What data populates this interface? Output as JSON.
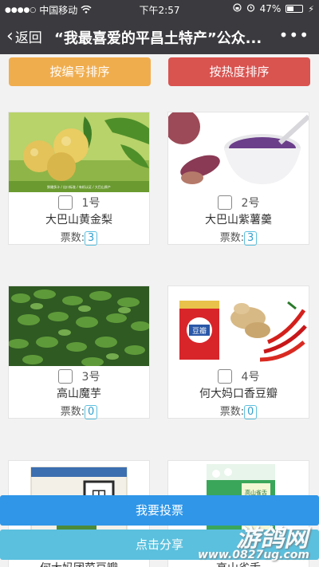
{
  "status_bar": {
    "carrier": "中国移动",
    "time": "下午2:57",
    "battery": "47%",
    "battery_level": 0.47
  },
  "nav": {
    "back_label": "返回",
    "title": "“我最喜爱的平昌土特产”公众...",
    "more": "•••"
  },
  "sort": {
    "by_number": "按编号排序",
    "by_heat": "按热度排序"
  },
  "votes_prefix": "票数:",
  "cards": [
    {
      "number": "1号",
      "name": "大巴山黄金梨",
      "votes": "3",
      "caption": "鲜嫩多汁 / 出口标准 / 有机认证 / 大巴山原产"
    },
    {
      "number": "2号",
      "name": "大巴山紫薯羹",
      "votes": "3"
    },
    {
      "number": "3号",
      "name": "高山魔芋",
      "votes": "0"
    },
    {
      "number": "4号",
      "name": "何大妈口香豆瓣",
      "votes": "0",
      "jar_label": "豆瓣"
    },
    {
      "number": "",
      "name": "何大妈团菜豆瓣",
      "votes": "",
      "box_label": "田"
    },
    {
      "number": "",
      "name": "高山雀舌",
      "votes": "",
      "bag_label": "高山雀舌"
    }
  ],
  "buttons": {
    "vote": "我要投票",
    "share": "点击分享"
  },
  "watermark": {
    "brand": "游鸽网",
    "url": "www.0827ug.com"
  }
}
